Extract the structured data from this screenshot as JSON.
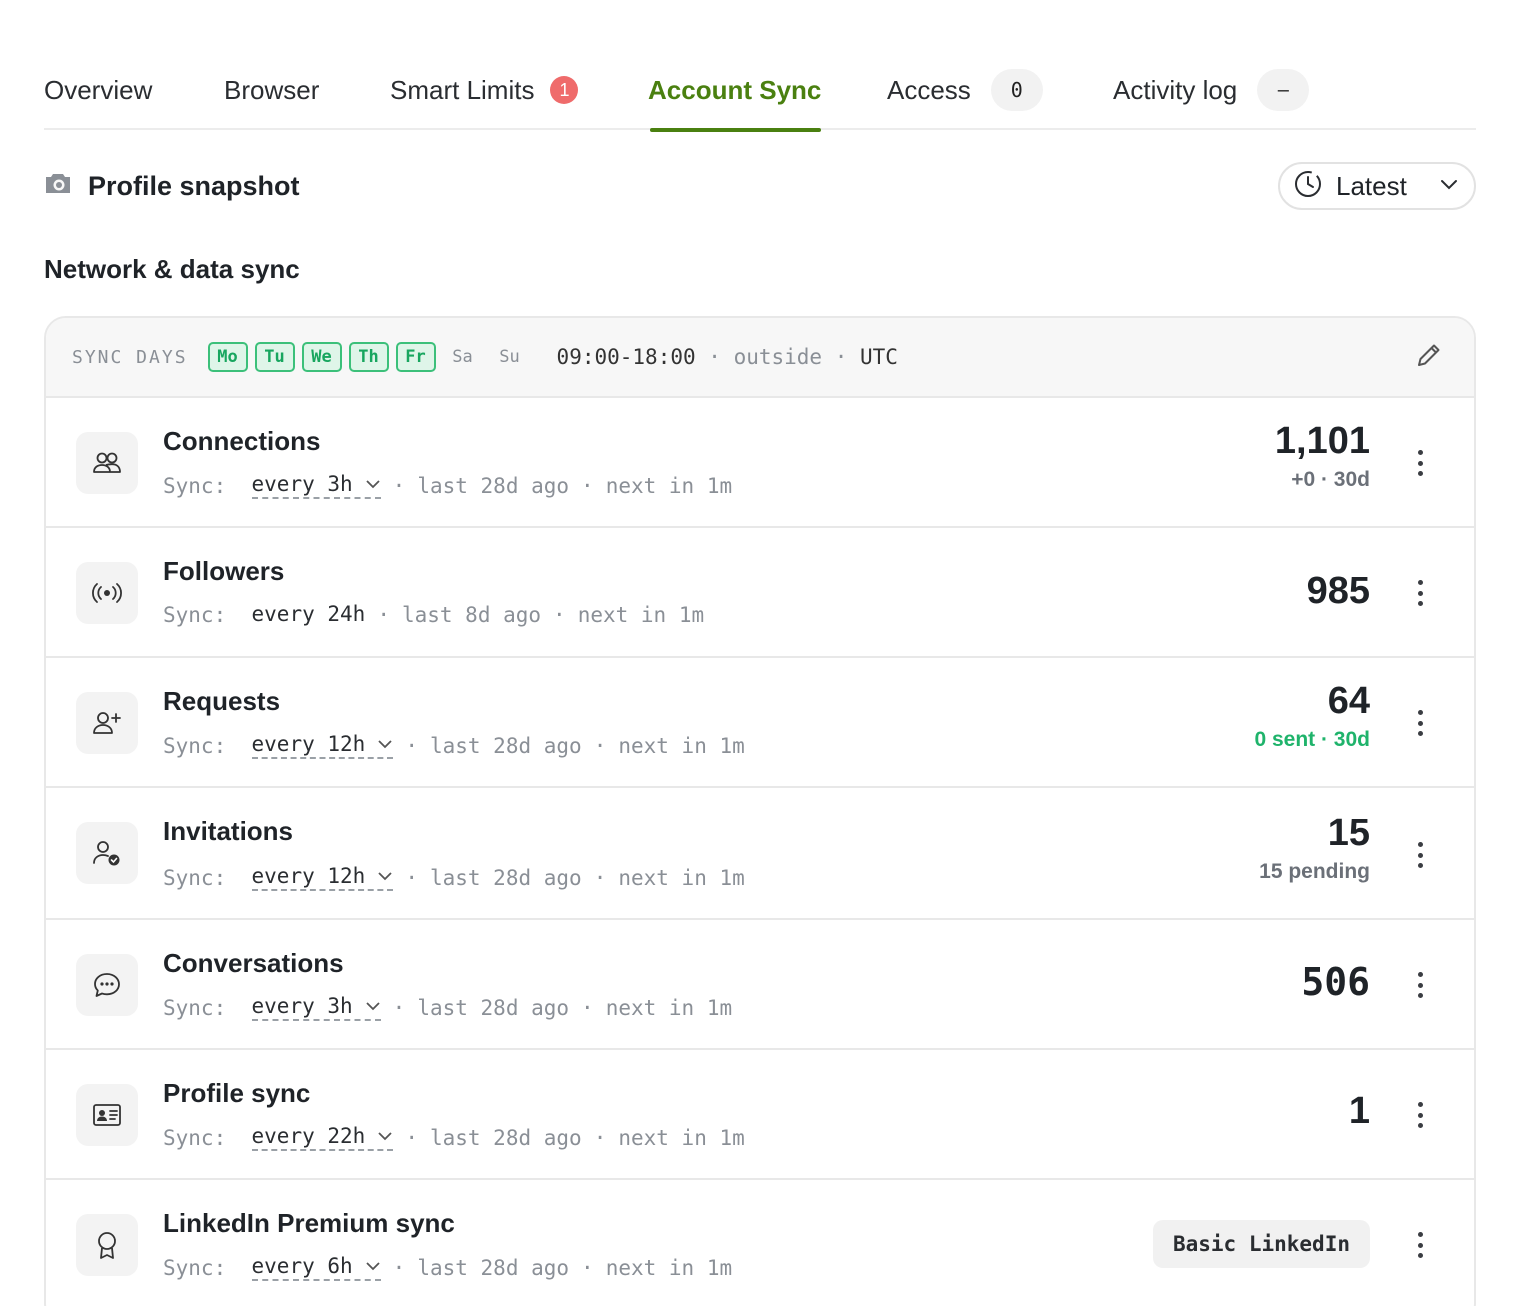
{
  "tabs": [
    {
      "label": "Overview"
    },
    {
      "label": "Browser"
    },
    {
      "label": "Smart Limits",
      "badge": "1"
    },
    {
      "label": "Account Sync",
      "active": true
    },
    {
      "label": "Access",
      "pill": "0"
    },
    {
      "label": "Activity log",
      "pill": "–"
    }
  ],
  "header": {
    "snapshot_title": "Profile snapshot",
    "snapshot_icon": "camera-icon",
    "history_select": {
      "value": "Latest",
      "icon": "clock-icon"
    }
  },
  "section_title": "Network & data sync",
  "sync_days": {
    "label": "SYNC DAYS",
    "days": [
      {
        "label": "Mo",
        "active": true
      },
      {
        "label": "Tu",
        "active": true
      },
      {
        "label": "We",
        "active": true
      },
      {
        "label": "Th",
        "active": true
      },
      {
        "label": "Fr",
        "active": true
      },
      {
        "label": "Sa",
        "active": false
      },
      {
        "label": "Su",
        "active": false
      }
    ],
    "time_window": "09:00-18:00",
    "status": "outside",
    "timezone": "UTC",
    "edit_icon": "pencil-icon"
  },
  "sync_label": "Sync:",
  "items": [
    {
      "name": "Connections",
      "icon": "users-icon",
      "frequency": "every 3h",
      "last": "last 28d ago",
      "next": "next in 1m",
      "count": "1,101",
      "sub": "+0 · 30d"
    },
    {
      "name": "Followers",
      "icon": "broadcast-icon",
      "frequency": "every 24h",
      "last": "last 8d ago",
      "next": "next in 1m",
      "count": "985"
    },
    {
      "name": "Requests",
      "icon": "user-plus-icon",
      "frequency": "every 12h",
      "last": "last 28d ago",
      "next": "next in 1m",
      "count": "64",
      "sub": "0 sent · 30d"
    },
    {
      "name": "Invitations",
      "icon": "user-check-icon",
      "frequency": "every 12h",
      "last": "last 28d ago",
      "next": "next in 1m",
      "count": "15",
      "sub": "15 pending"
    },
    {
      "name": "Conversations",
      "icon": "chat-bubble-icon",
      "frequency": "every 3h",
      "last": "last 28d ago",
      "next": "next in 1m",
      "count": "506"
    },
    {
      "name": "Profile sync",
      "icon": "id-card-icon",
      "frequency": "every 22h",
      "last": "last 28d ago",
      "next": "next in 1m",
      "count": "1"
    },
    {
      "name": "LinkedIn Premium sync",
      "icon": "award-icon",
      "frequency": "every 6h",
      "last": "last 28d ago",
      "next": "next in 1m",
      "plan": "Basic LinkedIn"
    }
  ],
  "colors": {
    "accent": "#4a8010",
    "day_active": "#18a65f",
    "badge_red": "#ef6b6b",
    "positive": "#1fb36b"
  }
}
